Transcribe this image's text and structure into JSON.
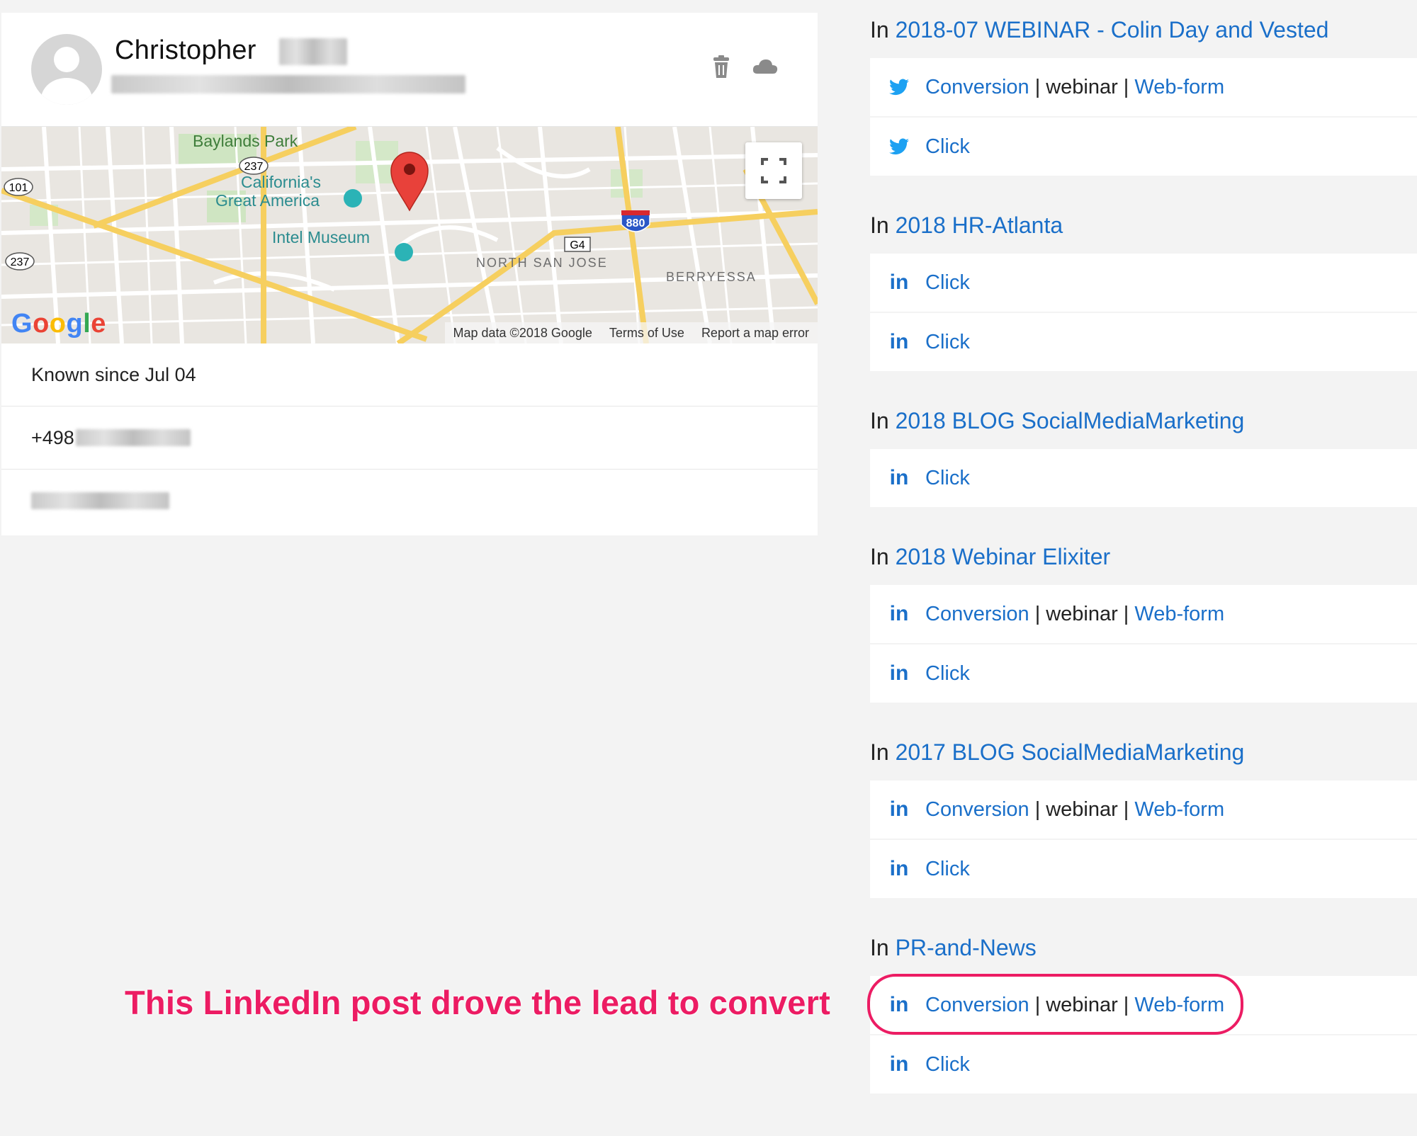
{
  "contact": {
    "name": "Christopher",
    "known_since": "Known since Jul 04",
    "phone_prefix": "+498",
    "actions": {
      "delete_icon": "trash-icon",
      "sync_icon": "cloud-icon"
    }
  },
  "map": {
    "labels": {
      "baylands": "Baylands Park",
      "california1": "California's",
      "california2": "Great America",
      "intel": "Intel Museum",
      "north_sj": "NORTH SAN JOSE",
      "berryessa": "BERRYESSA",
      "r237a": "237",
      "r237b": "237",
      "r101": "101",
      "g4": "G4",
      "i880": "880"
    },
    "google": "Google",
    "footer": {
      "data": "Map data ©2018 Google",
      "terms": "Terms of Use",
      "report": "Report a map error"
    }
  },
  "campaigns": [
    {
      "prefix": "In",
      "name": "2018-07 WEBINAR - Colin Day and Vested",
      "activities": [
        {
          "network": "twitter",
          "label": "Conversion",
          "type": "webinar",
          "form": "Web-form"
        },
        {
          "network": "twitter",
          "label": "Click"
        }
      ]
    },
    {
      "prefix": "In",
      "name": "2018 HR-Atlanta",
      "activities": [
        {
          "network": "linkedin",
          "label": "Click"
        },
        {
          "network": "linkedin",
          "label": "Click"
        }
      ]
    },
    {
      "prefix": "In",
      "name": "2018 BLOG SocialMediaMarketing",
      "activities": [
        {
          "network": "linkedin",
          "label": "Click"
        }
      ]
    },
    {
      "prefix": "In",
      "name": "2018 Webinar Elixiter",
      "activities": [
        {
          "network": "linkedin",
          "label": "Conversion",
          "type": "webinar",
          "form": "Web-form"
        },
        {
          "network": "linkedin",
          "label": "Click"
        }
      ]
    },
    {
      "prefix": "In",
      "name": "2017 BLOG SocialMediaMarketing",
      "activities": [
        {
          "network": "linkedin",
          "label": "Conversion",
          "type": "webinar",
          "form": "Web-form"
        },
        {
          "network": "linkedin",
          "label": "Click"
        }
      ]
    },
    {
      "prefix": "In",
      "name": "PR-and-News",
      "activities": [
        {
          "network": "linkedin",
          "label": "Conversion",
          "type": "webinar",
          "form": "Web-form"
        },
        {
          "network": "linkedin",
          "label": "Click"
        }
      ]
    }
  ],
  "annotation": {
    "text": "This LinkedIn post drove the lead to convert",
    "color": "#ec1c63"
  },
  "colors": {
    "link": "#1a6fc9",
    "twitter": "#1da1f2",
    "linkedin": "#1a6fc9"
  }
}
